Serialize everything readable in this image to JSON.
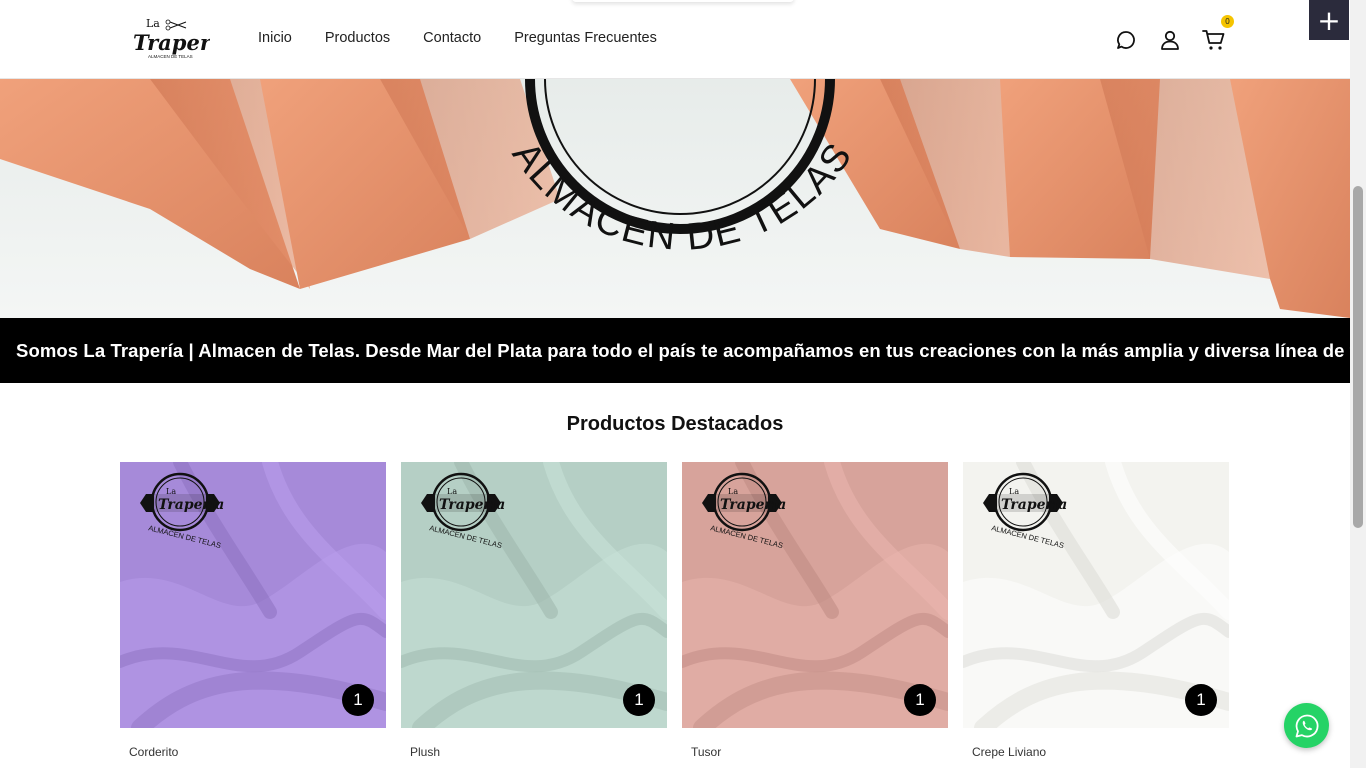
{
  "header": {
    "logo_alt": "La Trapería Almacen de Telas",
    "nav": [
      "Inicio",
      "Productos",
      "Contacto",
      "Preguntas Frecuentes"
    ],
    "cart_count": "0",
    "icons": [
      "chat-icon",
      "user-icon",
      "cart-icon"
    ]
  },
  "floating": {
    "plus_label": "+"
  },
  "hero": {
    "text": "ALMACEN DE TELAS"
  },
  "marquee": {
    "text": "Somos La Trapería | Almacen de Telas. Desde Mar del Plata para todo el país te acompañamos en tus creaciones con la más amplia y diversa línea de t"
  },
  "featured": {
    "title": "Productos Destacados",
    "products": [
      {
        "name": "Corderito",
        "qty": "1",
        "color": "#a68ad9"
      },
      {
        "name": "Plush",
        "qty": "1",
        "color": "#b5cfc5"
      },
      {
        "name": "Tusor",
        "qty": "1",
        "color": "#d7a39b"
      },
      {
        "name": "Crepe Liviano",
        "qty": "1",
        "color": "#f3f3ef"
      }
    ],
    "watermark": {
      "brand": "Traperia",
      "sub": "ALMACEN DE TELAS",
      "prefix": "La"
    }
  },
  "colors": {
    "accent": "#f5c400",
    "marquee_bg": "#000000",
    "whatsapp": "#25d366",
    "fabric": "#e9946e"
  }
}
